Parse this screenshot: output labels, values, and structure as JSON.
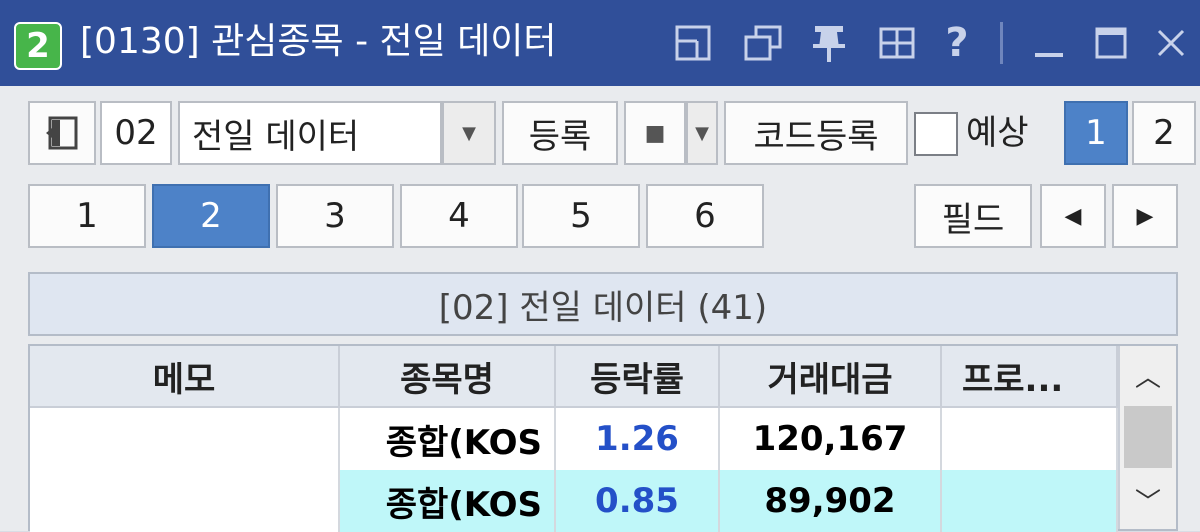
{
  "window": {
    "badge": "2",
    "title": "[0130] 관심종목 - 전일 데이터",
    "icons": [
      "layout-icon",
      "restore-window-icon",
      "pin-icon",
      "grid-icon",
      "help-icon",
      "minimize-icon",
      "maximize-icon",
      "close-icon"
    ],
    "help_glyph": "?"
  },
  "toolbar": {
    "group_no": "02",
    "group_name": "전일 데이터",
    "register_label": "등록",
    "code_register_label": "코드등록",
    "forecast_label": "예상",
    "page_tabs": [
      "1",
      "2"
    ],
    "selected_page": "1"
  },
  "view_tabs": {
    "tabs": [
      "1",
      "2",
      "3",
      "4",
      "5",
      "6"
    ],
    "selected": "2",
    "field_label": "필드"
  },
  "group_header": "[02] 전일 데이터 (41)",
  "table": {
    "columns": [
      "메모",
      "종목명",
      "등락률",
      "거래대금",
      "프로..."
    ],
    "rows": [
      {
        "memo": "",
        "name": "종합(KOS",
        "change": "1.26",
        "amount": "120,167",
        "program": ""
      },
      {
        "memo": "",
        "name": "종합(KOS",
        "change": "0.85",
        "amount": "89,902",
        "program": ""
      }
    ]
  },
  "colors": {
    "titlebar": "#304f99",
    "selected": "#4d82c8",
    "up_text": "#2450c8",
    "highlight_row": "#bff7f9"
  }
}
